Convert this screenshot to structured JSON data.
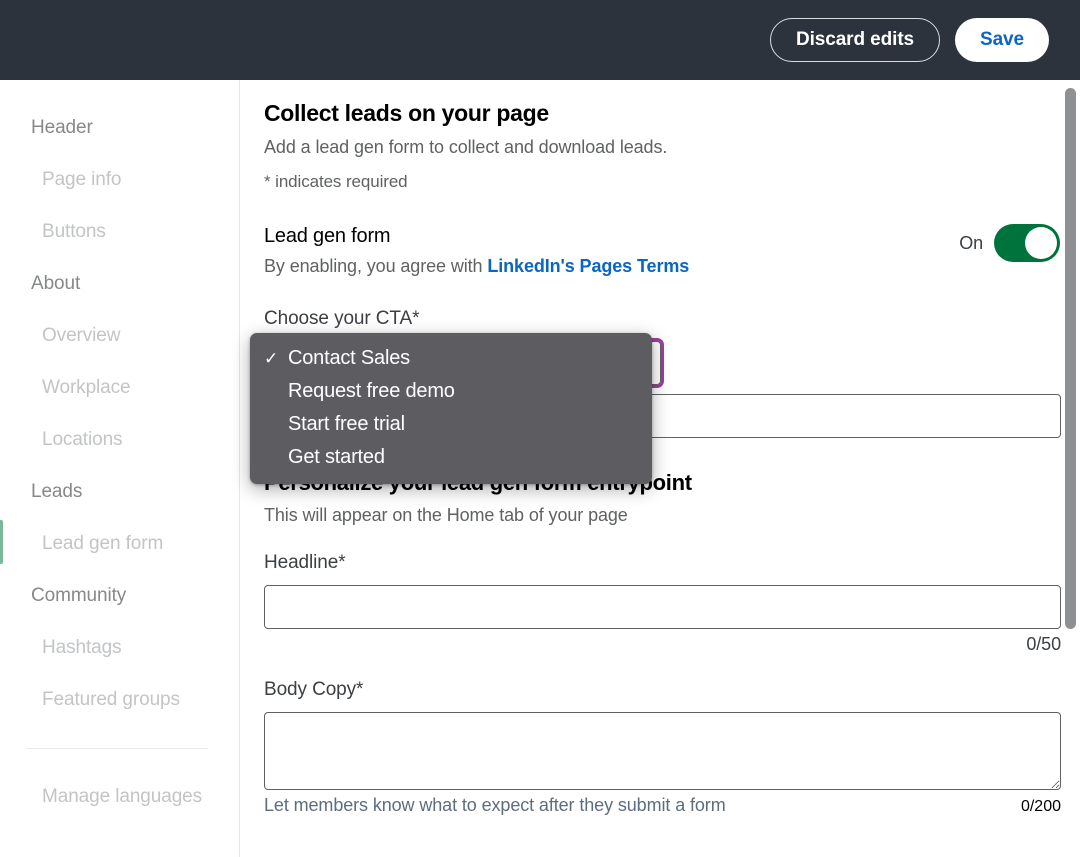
{
  "topbar": {
    "discard_label": "Discard edits",
    "save_label": "Save",
    "background_color": "#2c333d",
    "save_text_color": "#0a66c2"
  },
  "sidebar": {
    "groups": [
      {
        "heading": "Header",
        "items": [
          {
            "label": "Page info",
            "active": false
          },
          {
            "label": "Buttons",
            "active": false
          }
        ]
      },
      {
        "heading": "About",
        "items": [
          {
            "label": "Overview",
            "active": false
          },
          {
            "label": "Workplace",
            "active": false
          },
          {
            "label": "Locations",
            "active": false
          }
        ]
      },
      {
        "heading": "Leads",
        "items": [
          {
            "label": "Lead gen form",
            "active": true
          }
        ]
      },
      {
        "heading": "Community",
        "items": [
          {
            "label": "Hashtags",
            "active": false
          },
          {
            "label": "Featured groups",
            "active": false
          }
        ]
      }
    ],
    "footer_item": "Manage languages",
    "active_indicator_color": "#7bb89a"
  },
  "main": {
    "title": "Collect leads on your page",
    "subtitle": "Add a lead gen form to collect and download leads.",
    "required_note": "* indicates required",
    "lead_gen_form": {
      "label": "Lead gen form",
      "agree_prefix": "By enabling, you agree with ",
      "terms_link": "LinkedIn's Pages Terms",
      "toggle_state_label": "On",
      "toggle_on": true,
      "toggle_color": "#00733c"
    },
    "cta": {
      "label": "Choose your CTA*",
      "selected": "Contact Sales",
      "focus_ring_color": "#a03ca0",
      "options": [
        {
          "label": "Contact Sales",
          "checked": true
        },
        {
          "label": "Request free demo",
          "checked": false
        },
        {
          "label": "Start free trial",
          "checked": false
        },
        {
          "label": "Get started",
          "checked": false
        }
      ]
    },
    "landing_url": {
      "value": "",
      "placeholder": ""
    },
    "personalize": {
      "title": "Personalize your lead gen form entrypoint",
      "subtitle": "This will appear on the Home tab of your page",
      "headline": {
        "label": "Headline*",
        "value": "",
        "placeholder": "",
        "counter": "0/50"
      },
      "body_copy": {
        "label": "Body Copy*",
        "value": "",
        "placeholder": "",
        "counter": "0/200",
        "helper": "Let members know what to expect after they submit a form"
      }
    }
  },
  "icons": {
    "check": "✓"
  }
}
